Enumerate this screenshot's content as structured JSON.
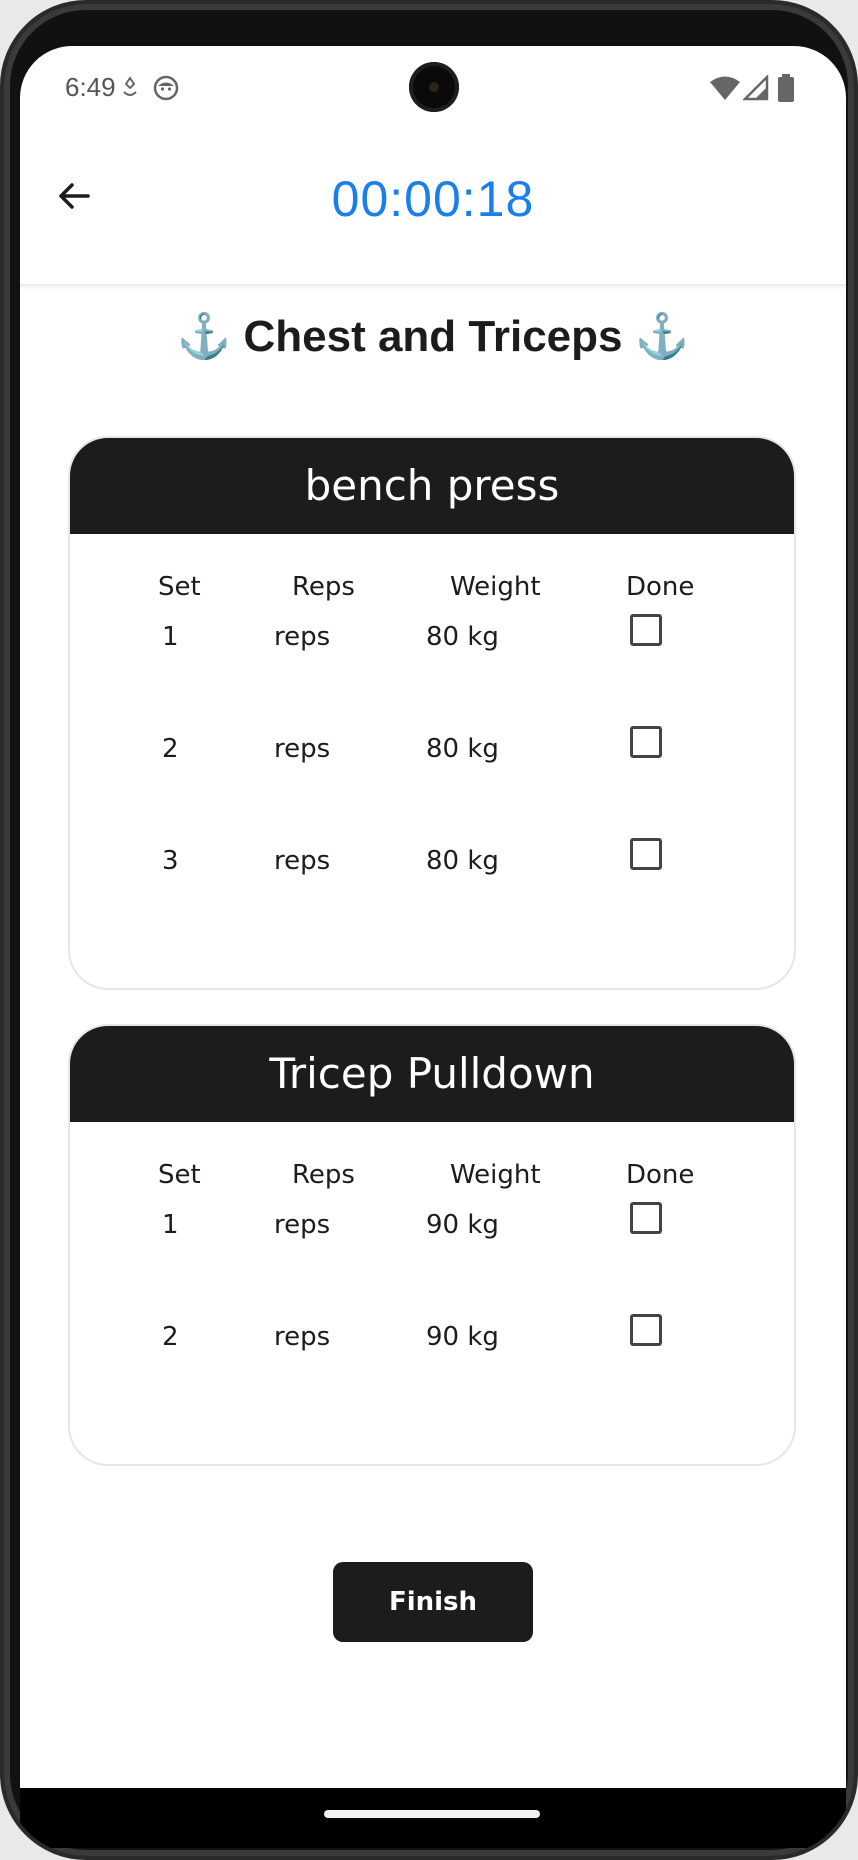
{
  "status_bar": {
    "time": "6:49",
    "left_icons": [
      "location-drop-icon",
      "face-notification-icon"
    ],
    "right_icons": [
      "wifi-icon",
      "signal-icon",
      "battery-icon"
    ]
  },
  "app_bar": {
    "timer": "00:00:18",
    "back_icon": "arrow-left-icon",
    "timer_color": "#1a7fe8"
  },
  "workout": {
    "title": "Chest and Triceps",
    "title_emoji": "⚓"
  },
  "exercises": [
    {
      "name": "bench press",
      "columns": [
        "Set",
        "Reps",
        "Weight",
        "Done"
      ],
      "sets": [
        {
          "set": "1",
          "reps": "reps",
          "weight": "80 kg",
          "done": false
        },
        {
          "set": "2",
          "reps": "reps",
          "weight": "80 kg",
          "done": false
        },
        {
          "set": "3",
          "reps": "reps",
          "weight": "80 kg",
          "done": false
        }
      ]
    },
    {
      "name": "Tricep Pulldown",
      "columns": [
        "Set",
        "Reps",
        "Weight",
        "Done"
      ],
      "sets": [
        {
          "set": "1",
          "reps": "reps",
          "weight": "90 kg",
          "done": false
        },
        {
          "set": "2",
          "reps": "reps",
          "weight": "90 kg",
          "done": false
        }
      ]
    }
  ],
  "actions": {
    "finish_label": "Finish"
  },
  "colors": {
    "header_bg": "#1c1c1c",
    "accent": "#1a7fe8"
  }
}
